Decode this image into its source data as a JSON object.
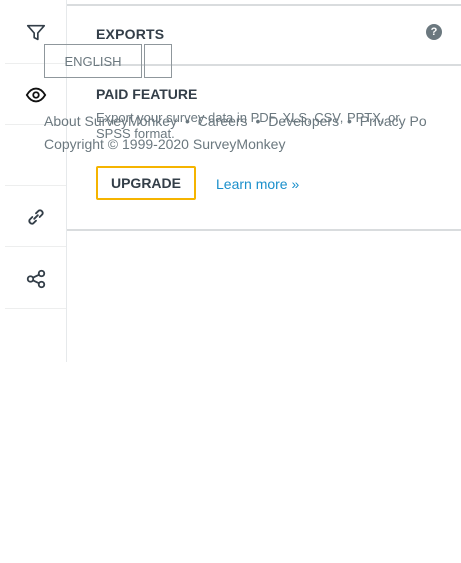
{
  "rail": {
    "icons": [
      "filter-icon",
      "eye-icon",
      "link-icon",
      "share-icon"
    ]
  },
  "exports": {
    "title": "EXPORTS",
    "help_symbol": "?",
    "paid_title": "PAID FEATURE",
    "description": "Export your survey data in PDF, XLS, CSV, PPTX, or SPSS format.",
    "upgrade_label": "UPGRADE",
    "learn_more_label": "Learn more »"
  },
  "footer": {
    "language_label": "ENGLISH",
    "links": [
      "About SurveyMonkey",
      "•",
      "Careers",
      "•",
      "Developers",
      "•",
      "Privacy Po"
    ],
    "copyright": "Copyright © 1999-2020 SurveyMonkey"
  },
  "colors": {
    "accent_border": "#f5b400",
    "link": "#1a8fcb",
    "text": "#333e48",
    "muted": "#6b787f"
  }
}
